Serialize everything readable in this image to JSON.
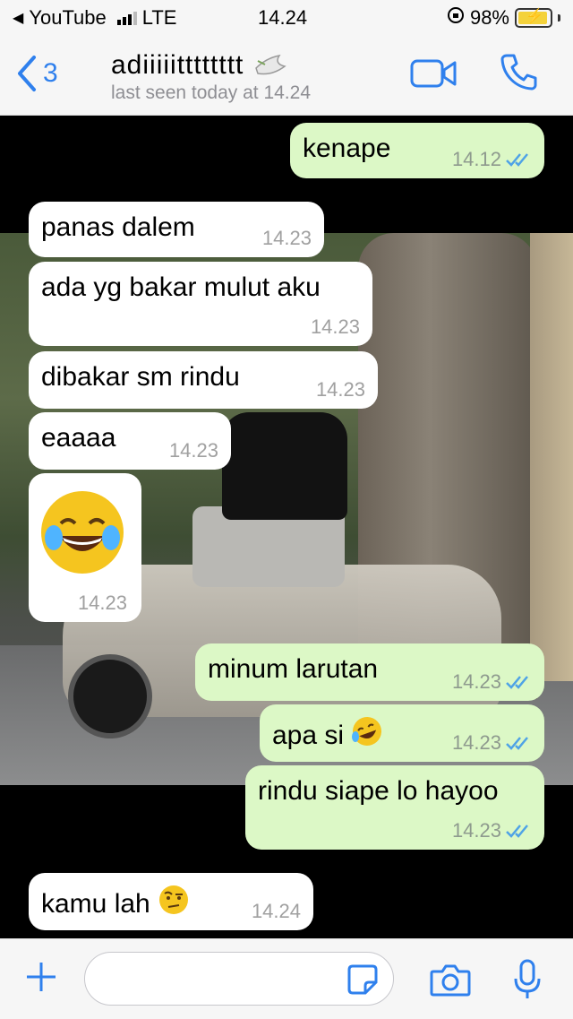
{
  "status_bar": {
    "back_app": "YouTube",
    "network": "LTE",
    "time": "14.24",
    "battery": "98%"
  },
  "header": {
    "back_count": "3",
    "contact_name": "adiiiiitttttttt",
    "last_seen": "last seen today at 14.24"
  },
  "messages": [
    {
      "dir": "out",
      "text": "kenape",
      "time": "14.12",
      "read": true
    },
    {
      "dir": "in",
      "text": "panas dalem",
      "time": "14.23"
    },
    {
      "dir": "in",
      "text": "ada yg bakar mulut aku",
      "time": "14.23"
    },
    {
      "dir": "in",
      "text": "dibakar sm rindu",
      "time": "14.23"
    },
    {
      "dir": "in",
      "text": "eaaaa",
      "time": "14.23"
    },
    {
      "dir": "in",
      "text": "",
      "emoji": "tears-of-joy",
      "time": "14.23"
    },
    {
      "dir": "out",
      "text": "minum larutan",
      "time": "14.23",
      "read": true
    },
    {
      "dir": "out",
      "text": "apa si",
      "emoji": "rolling-on-floor-laughing",
      "time": "14.23",
      "read": true
    },
    {
      "dir": "out",
      "text": "rindu siape lo hayoo",
      "time": "14.23",
      "read": true
    },
    {
      "dir": "in",
      "text": "kamu lah",
      "emoji": "face-with-raised-eyebrow",
      "time": "14.24"
    }
  ],
  "colors": {
    "accent": "#2f80ed",
    "outgoing": "#dcf8c6",
    "incoming": "#ffffff",
    "read_ticks": "#4fa3e6"
  }
}
